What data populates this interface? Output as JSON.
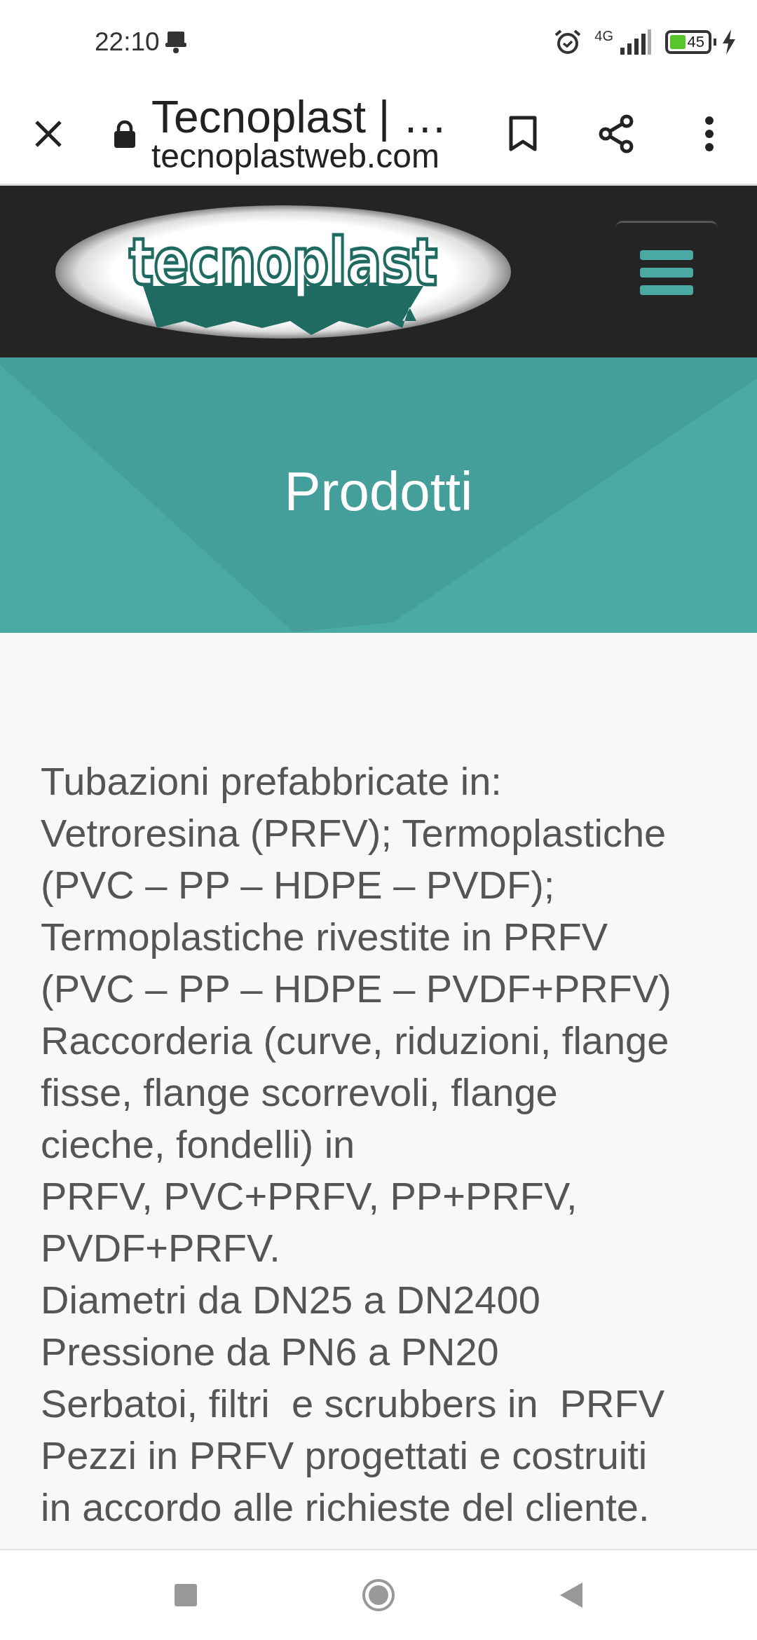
{
  "status_bar": {
    "time": "22:10",
    "network": "4G",
    "battery": "45"
  },
  "browser_bar": {
    "title": "Tecnoplast | …",
    "url": "tecnoplastweb.com"
  },
  "site_header": {
    "logo": "tecnoplast"
  },
  "banner": {
    "title": "Prodotti"
  },
  "content": {
    "lines": [
      "Tubazioni prefabbricate in:",
      "Vetroresina (PRFV); Termoplastiche",
      "(PVC – PP – HDPE – PVDF);",
      "Termoplastiche rivestite in PRFV",
      "(PVC – PP – HDPE – PVDF+PRFV)",
      "Raccorderia (curve, riduzioni, flange",
      "fisse, flange scorrevoli, flange",
      "cieche, fondelli) in",
      "PRFV, PVC+PRFV, PP+PRFV,",
      "PVDF+PRFV.",
      "Diametri da DN25 a DN2400",
      "Pressione da PN6 a PN20",
      "Serbatoi, filtri  e scrubbers in  PRFV",
      "Pezzi in PRFV progettati e costruiti",
      "in accordo alle richieste del cliente."
    ]
  }
}
